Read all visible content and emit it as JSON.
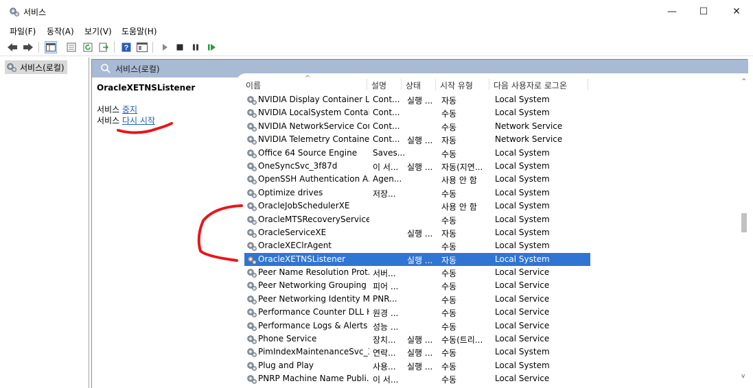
{
  "window": {
    "title": "서비스",
    "minimize_glyph": "—",
    "maximize_glyph": "☐",
    "close_glyph": "✕"
  },
  "menu": [
    "파일(F)",
    "동작(A)",
    "보기(V)",
    "도움말(H)"
  ],
  "toolbar_icons": [
    "back-icon",
    "forward-icon",
    "console-tree-icon",
    "properties-icon",
    "refresh-icon",
    "export-icon",
    "help-icon",
    "view-icon",
    "start-icon",
    "stop-icon",
    "pause-icon",
    "resume-icon"
  ],
  "tree": {
    "root_label": "서비스(로컬)"
  },
  "content_header": {
    "title": "서비스(로컬)"
  },
  "description": {
    "service_name": "OracleXETNSListener",
    "stop_prefix": "서비스 ",
    "stop_link": "중지",
    "restart_prefix": "서비스 ",
    "restart_link": "다시 시작"
  },
  "columns": {
    "name": "이름",
    "description": "설명",
    "status": "상태",
    "startup": "시작 유형",
    "logon": "다음 사용자로 로그온"
  },
  "rows": [
    {
      "name": "NVIDIA Display Container LS",
      "desc": "Cont...",
      "status": "실행 ...",
      "startup": "자동",
      "logon": "Local System"
    },
    {
      "name": "NVIDIA LocalSystem Contai...",
      "desc": "Cont...",
      "status": "",
      "startup": "수동",
      "logon": "Local System"
    },
    {
      "name": "NVIDIA NetworkService Con...",
      "desc": "Cont...",
      "status": "",
      "startup": "수동",
      "logon": "Network Service"
    },
    {
      "name": "NVIDIA Telemetry Container",
      "desc": "Cont...",
      "status": "실행 ...",
      "startup": "자동",
      "logon": "Network Service"
    },
    {
      "name": "Office 64 Source Engine",
      "desc": "Saves...",
      "status": "",
      "startup": "수동",
      "logon": "Local System"
    },
    {
      "name": "OneSyncSvc_3f87d",
      "desc": "이 서...",
      "status": "실행 ...",
      "startup": "자동(지연...",
      "logon": "Local System"
    },
    {
      "name": "OpenSSH Authentication A...",
      "desc": "Agen...",
      "status": "",
      "startup": "사용 안 함",
      "logon": "Local System"
    },
    {
      "name": "Optimize drives",
      "desc": "저장...",
      "status": "",
      "startup": "수동",
      "logon": "Local System"
    },
    {
      "name": "OracleJobSchedulerXE",
      "desc": "",
      "status": "",
      "startup": "사용 안 함",
      "logon": "Local System"
    },
    {
      "name": "OracleMTSRecoveryService",
      "desc": "",
      "status": "",
      "startup": "수동",
      "logon": "Local System"
    },
    {
      "name": "OracleServiceXE",
      "desc": "",
      "status": "실행 ...",
      "startup": "자동",
      "logon": "Local System"
    },
    {
      "name": "OracleXEClrAgent",
      "desc": "",
      "status": "",
      "startup": "수동",
      "logon": "Local System"
    },
    {
      "name": "OracleXETNSListener",
      "desc": "",
      "status": "실행 ...",
      "startup": "자동",
      "logon": "Local System"
    },
    {
      "name": "Peer Name Resolution Prot...",
      "desc": "서버...",
      "status": "",
      "startup": "수동",
      "logon": "Local Service"
    },
    {
      "name": "Peer Networking Grouping",
      "desc": "피어 ...",
      "status": "",
      "startup": "수동",
      "logon": "Local Service"
    },
    {
      "name": "Peer Networking Identity M...",
      "desc": "PNR...",
      "status": "",
      "startup": "수동",
      "logon": "Local Service"
    },
    {
      "name": "Performance Counter DLL H...",
      "desc": "원경 ...",
      "status": "",
      "startup": "수동",
      "logon": "Local Service"
    },
    {
      "name": "Performance Logs & Alerts",
      "desc": "성능 ...",
      "status": "",
      "startup": "수동",
      "logon": "Local Service"
    },
    {
      "name": "Phone Service",
      "desc": "장치...",
      "status": "실행 ...",
      "startup": "수동(트리...",
      "logon": "Local Service"
    },
    {
      "name": "PimIndexMaintenanceSvc_3f...",
      "desc": "연락...",
      "status": "실행 ...",
      "startup": "수동",
      "logon": "Local System"
    },
    {
      "name": "Plug and Play",
      "desc": "사용...",
      "status": "실행 ...",
      "startup": "수동",
      "logon": "Local System"
    },
    {
      "name": "PNRP Machine Name Publi...",
      "desc": "이 서...",
      "status": "",
      "startup": "수동",
      "logon": "Local Service"
    }
  ],
  "selected_row": 12,
  "colors": {
    "selection": "#3175d3",
    "header_band": "#a8bad4",
    "link": "#1a5fb4",
    "annotation": "#e8161b"
  }
}
